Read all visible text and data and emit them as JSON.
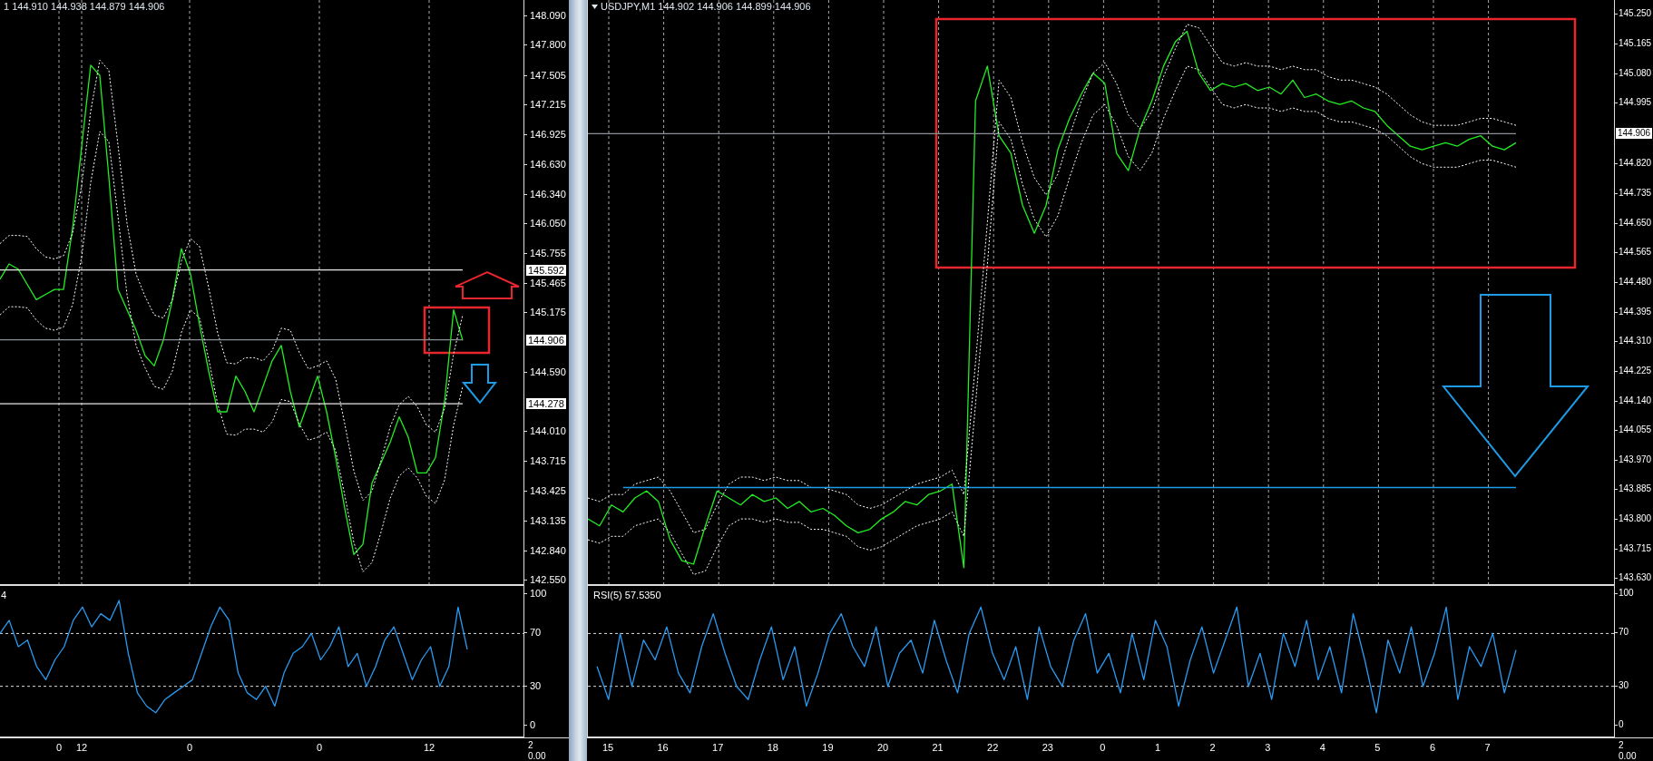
{
  "charts": [
    {
      "header": "1 144.910 144.938 144.879 144.906",
      "chart_data": {
        "type": "line",
        "ylim": [
          142.5,
          148.24
        ],
        "grid": true,
        "yticks": [
          {
            "value": 148.09,
            "label": "148.090"
          },
          {
            "value": 147.8,
            "label": "147.800"
          },
          {
            "value": 147.505,
            "label": "147.505"
          },
          {
            "value": 147.215,
            "label": "147.215"
          },
          {
            "value": 146.925,
            "label": "146.925"
          },
          {
            "value": 146.63,
            "label": "146.630"
          },
          {
            "value": 146.34,
            "label": "146.340"
          },
          {
            "value": 146.05,
            "label": "146.050"
          },
          {
            "value": 145.755,
            "label": "145.755"
          },
          {
            "value": 145.465,
            "label": "145.465"
          },
          {
            "value": 145.175,
            "label": "145.175"
          },
          {
            "value": 144.59,
            "label": "144.590"
          },
          {
            "value": 144.01,
            "label": "144.010"
          },
          {
            "value": 143.715,
            "label": "143.715"
          },
          {
            "value": 143.425,
            "label": "143.425"
          },
          {
            "value": 143.135,
            "label": "143.135"
          },
          {
            "value": 142.84,
            "label": "142.840"
          },
          {
            "value": 142.55,
            "label": "142.550"
          }
        ],
        "series": [
          {
            "color": "#22ee22",
            "values": [
              145.5,
              145.65,
              145.6,
              145.45,
              145.3,
              145.35,
              145.4,
              145.4,
              146.0,
              146.8,
              147.6,
              147.5,
              146.5,
              145.4,
              145.2,
              145.0,
              144.75,
              144.65,
              144.9,
              145.3,
              145.8,
              145.55,
              145.05,
              144.6,
              144.2,
              144.2,
              144.55,
              144.4,
              144.2,
              144.45,
              144.7,
              144.85,
              144.4,
              144.05,
              144.3,
              144.55,
              144.2,
              143.75,
              143.25,
              142.8,
              142.9,
              143.5,
              143.7,
              143.9,
              144.15,
              143.95,
              143.6,
              143.6,
              143.75,
              144.3,
              145.2,
              144.9
            ]
          },
          {
            "line_style": "dashed",
            "color": "#ffffff",
            "values": [
              145.85,
              145.93,
              145.93,
              145.92,
              145.8,
              145.72,
              145.7,
              145.73,
              145.95,
              146.42,
              147.15,
              147.65,
              147.55,
              146.82,
              146.05,
              145.55,
              145.33,
              145.15,
              145.12,
              145.3,
              145.68,
              145.9,
              145.82,
              145.42,
              144.97,
              144.68,
              144.67,
              144.73,
              144.73,
              144.7,
              144.8,
              145.02,
              145.0,
              144.78,
              144.62,
              144.65,
              144.7,
              144.52,
              144.08,
              143.62,
              143.33,
              143.42,
              143.72,
              144.05,
              144.27,
              144.35,
              144.25,
              144.07,
              144.0,
              144.23,
              144.77,
              145.15
            ]
          },
          {
            "color": "#e8e8e8",
            "values": [
              145.592,
              145.592,
              145.592,
              145.592,
              145.592,
              145.592,
              145.592,
              145.592,
              145.592,
              145.592,
              145.592,
              145.592,
              145.592,
              145.592,
              145.592,
              145.592,
              145.592,
              145.592,
              145.592,
              145.592,
              145.592,
              145.592,
              145.592,
              145.592,
              145.592,
              145.592,
              145.592,
              145.592,
              145.592,
              145.592,
              145.592,
              145.592,
              145.592,
              145.592,
              145.592,
              145.592,
              145.592,
              145.592,
              145.592,
              145.592,
              145.592,
              145.592,
              145.592,
              145.592,
              145.592,
              145.592,
              145.592,
              145.592,
              145.592,
              145.592,
              145.592,
              145.592
            ]
          },
          {
            "color": "#8a8f96",
            "values": [
              144.906,
              144.906,
              144.906,
              144.906,
              144.906,
              144.906,
              144.906,
              144.906,
              144.906,
              144.906,
              144.906,
              144.906,
              144.906,
              144.906,
              144.906,
              144.906,
              144.906,
              144.906,
              144.906,
              144.906,
              144.906,
              144.906,
              144.906,
              144.906,
              144.906,
              144.906,
              144.906,
              144.906,
              144.906,
              144.906,
              144.906,
              144.906,
              144.906,
              144.906,
              144.906,
              144.906,
              144.906,
              144.906,
              144.906,
              144.906,
              144.906,
              144.906,
              144.906,
              144.906,
              144.906,
              144.906,
              144.906,
              144.906,
              144.906,
              144.906,
              144.906,
              144.906
            ]
          },
          {
            "color": "#e8e8e8",
            "values": [
              144.278,
              144.278,
              144.278,
              144.278,
              144.278,
              144.278,
              144.278,
              144.278,
              144.278,
              144.278,
              144.278,
              144.278,
              144.278,
              144.278,
              144.278,
              144.278,
              144.278,
              144.278,
              144.278,
              144.278,
              144.278,
              144.278,
              144.278,
              144.278,
              144.278,
              144.278,
              144.278,
              144.278,
              144.278,
              144.278,
              144.278,
              144.278,
              144.278,
              144.278,
              144.278,
              144.278,
              144.278,
              144.278,
              144.278,
              144.278,
              144.278,
              144.278,
              144.278,
              144.278,
              144.278,
              144.278,
              144.278,
              144.278,
              144.278,
              144.278,
              144.278,
              144.278
            ]
          },
          {
            "line_style": "dashed",
            "color": "#ffffff",
            "values": [
              145.15,
              145.23,
              145.23,
              145.22,
              145.1,
              145.02,
              145.0,
              145.03,
              145.25,
              145.72,
              146.45,
              146.95,
              146.85,
              146.12,
              145.35,
              144.85,
              144.63,
              144.45,
              144.42,
              144.6,
              144.98,
              145.2,
              145.12,
              144.72,
              144.27,
              143.98,
              143.97,
              144.03,
              144.03,
              144.0,
              144.1,
              144.32,
              144.3,
              144.08,
              143.92,
              143.95,
              144.0,
              143.82,
              143.38,
              142.92,
              142.63,
              142.72,
              143.02,
              143.35,
              143.57,
              143.65,
              143.55,
              143.37,
              143.3,
              143.53,
              144.07,
              144.45
            ]
          }
        ]
      },
      "levels": [
        {
          "label": "145.592"
        },
        {
          "label": "144.906"
        },
        {
          "label": "144.278"
        }
      ],
      "annotations": [
        {
          "kind": "frame",
          "color": "#e8262e"
        },
        {
          "kind": "up-arrow",
          "color": "#e8262e"
        },
        {
          "kind": "down-arrow",
          "color": "#1e9be6"
        }
      ],
      "rsi": {
        "label": "4",
        "chart_data": {
          "type": "line",
          "ylim": [
            -8,
            106
          ],
          "yticks": [
            {
              "value": 100,
              "label": "100"
            },
            {
              "value": 70,
              "label": "70"
            },
            {
              "value": 30,
              "label": "30"
            },
            {
              "value": 0,
              "label": "0"
            }
          ],
          "series": [
            {
              "color": "#2a9af0",
              "values": [
                70,
                80,
                60,
                65,
                45,
                35,
                50,
                60,
                80,
                90,
                75,
                85,
                80,
                95,
                55,
                25,
                15,
                10,
                20,
                25,
                30,
                35,
                55,
                75,
                90,
                80,
                40,
                25,
                20,
                30,
                15,
                40,
                55,
                60,
                70,
                50,
                60,
                75,
                45,
                55,
                30,
                45,
                65,
                75,
                55,
                35,
                50,
                60,
                30,
                45,
                90,
                58
              ]
            }
          ]
        }
      },
      "time_axis": [
        "0",
        "12",
        "0",
        "0",
        "12"
      ],
      "sub_axis": [
        "2",
        "0.00"
      ]
    },
    {
      "header": "USDJPY,M1  144.902 144.906 144.899 144.906",
      "marker": true,
      "chart_data": {
        "type": "line",
        "ylim": [
          143.61,
          145.29
        ],
        "grid": true,
        "yticks": [
          {
            "value": 145.25,
            "label": "145.250"
          },
          {
            "value": 145.165,
            "label": "145.165"
          },
          {
            "value": 145.08,
            "label": "145.080"
          },
          {
            "value": 144.995,
            "label": "144.995"
          },
          {
            "value": 144.82,
            "label": "144.820"
          },
          {
            "value": 144.735,
            "label": "144.735"
          },
          {
            "value": 144.65,
            "label": "144.650"
          },
          {
            "value": 144.565,
            "label": "144.565"
          },
          {
            "value": 144.48,
            "label": "144.480"
          },
          {
            "value": 144.395,
            "label": "144.395"
          },
          {
            "value": 144.31,
            "label": "144.310"
          },
          {
            "value": 144.225,
            "label": "144.225"
          },
          {
            "value": 144.14,
            "label": "144.140"
          },
          {
            "value": 144.055,
            "label": "144.055"
          },
          {
            "value": 143.97,
            "label": "143.970"
          },
          {
            "value": 143.885,
            "label": "143.885"
          },
          {
            "value": 143.8,
            "label": "143.800"
          },
          {
            "value": 143.715,
            "label": "143.715"
          },
          {
            "value": 143.63,
            "label": "143.630"
          }
        ],
        "series": [
          {
            "color": "#22ee22",
            "values": [
              143.8,
              143.78,
              143.84,
              143.82,
              143.86,
              143.88,
              143.85,
              143.74,
              143.68,
              143.67,
              143.78,
              143.88,
              143.86,
              143.84,
              143.87,
              143.85,
              143.86,
              143.83,
              143.85,
              143.82,
              143.83,
              143.81,
              143.78,
              143.76,
              143.77,
              143.8,
              143.82,
              143.85,
              143.84,
              143.87,
              143.88,
              143.9,
              143.66,
              145.0,
              145.1,
              144.9,
              144.85,
              144.7,
              144.62,
              144.7,
              144.86,
              144.95,
              145.02,
              145.08,
              145.05,
              144.85,
              144.8,
              144.92,
              145.0,
              145.1,
              145.17,
              145.2,
              145.08,
              145.03,
              145.05,
              145.04,
              145.05,
              145.03,
              145.04,
              145.02,
              145.06,
              145.01,
              145.02,
              145.0,
              144.99,
              145.0,
              144.98,
              144.97,
              144.93,
              144.9,
              144.87,
              144.86,
              144.87,
              144.88,
              144.87,
              144.89,
              144.9,
              144.87,
              144.86,
              144.88
            ]
          },
          {
            "line_style": "dashed",
            "color": "#ffffff",
            "values": [
              143.86,
              143.85,
              143.87,
              143.87,
              143.9,
              143.91,
              143.92,
              143.88,
              143.82,
              143.76,
              143.77,
              143.84,
              143.9,
              143.92,
              143.92,
              143.91,
              143.92,
              143.91,
              143.91,
              143.89,
              143.89,
              143.88,
              143.87,
              143.84,
              143.83,
              143.84,
              143.86,
              143.88,
              143.9,
              143.91,
              143.92,
              143.94,
              143.87,
              144.25,
              144.65,
              145.06,
              145.01,
              144.88,
              144.78,
              144.73,
              144.79,
              144.9,
              145.0,
              145.08,
              145.11,
              145.05,
              144.96,
              144.92,
              144.97,
              145.07,
              145.15,
              145.22,
              145.21,
              145.16,
              145.11,
              145.1,
              145.11,
              145.1,
              145.1,
              145.09,
              145.1,
              145.09,
              145.09,
              145.07,
              145.06,
              145.06,
              145.05,
              145.04,
              145.02,
              144.99,
              144.96,
              144.94,
              144.93,
              144.93,
              144.93,
              144.94,
              144.95,
              144.95,
              144.94,
              144.93
            ]
          },
          {
            "color": "#8a8f96",
            "values": [
              144.906,
              144.906,
              144.906,
              144.906,
              144.906,
              144.906,
              144.906,
              144.906,
              144.906,
              144.906,
              144.906,
              144.906,
              144.906,
              144.906,
              144.906,
              144.906,
              144.906,
              144.906,
              144.906,
              144.906,
              144.906,
              144.906,
              144.906,
              144.906,
              144.906,
              144.906,
              144.906,
              144.906,
              144.906,
              144.906,
              144.906,
              144.906,
              144.906,
              144.906,
              144.906,
              144.906,
              144.906,
              144.906,
              144.906,
              144.906,
              144.906,
              144.906,
              144.906,
              144.906,
              144.906,
              144.906,
              144.906,
              144.906,
              144.906,
              144.906,
              144.906,
              144.906,
              144.906,
              144.906,
              144.906,
              144.906,
              144.906,
              144.906,
              144.906,
              144.906,
              144.906,
              144.906,
              144.906,
              144.906,
              144.906,
              144.906,
              144.906,
              144.906,
              144.906,
              144.906,
              144.906,
              144.906,
              144.906,
              144.906,
              144.906,
              144.906,
              144.906,
              144.906,
              144.906,
              144.906
            ]
          },
          {
            "color": "#1e9be6",
            "values": [
              null,
              null,
              null,
              143.89,
              143.89,
              143.89,
              143.89,
              143.89,
              143.89,
              143.89,
              143.89,
              143.89,
              143.89,
              143.89,
              143.89,
              143.89,
              143.89,
              143.89,
              143.89,
              143.89,
              143.89,
              143.89,
              143.89,
              143.89,
              143.89,
              143.89,
              143.89,
              143.89,
              143.89,
              143.89,
              143.89,
              143.89,
              143.89,
              143.89,
              143.89,
              143.89,
              143.89,
              143.89,
              143.89,
              143.89,
              143.89,
              143.89,
              143.89,
              143.89,
              143.89,
              143.89,
              143.89,
              143.89,
              143.89,
              143.89,
              143.89,
              143.89,
              143.89,
              143.89,
              143.89,
              143.89,
              143.89,
              143.89,
              143.89,
              143.89,
              143.89,
              143.89,
              143.89,
              143.89,
              143.89,
              143.89,
              143.89,
              143.89,
              143.89,
              143.89,
              143.89,
              143.89,
              143.89,
              143.89,
              143.89,
              143.89,
              143.89,
              143.89,
              143.89,
              143.89
            ]
          },
          {
            "line_style": "dashed",
            "color": "#ffffff",
            "values": [
              143.74,
              143.73,
              143.75,
              143.75,
              143.78,
              143.79,
              143.8,
              143.76,
              143.7,
              143.64,
              143.65,
              143.72,
              143.78,
              143.8,
              143.8,
              143.79,
              143.8,
              143.79,
              143.79,
              143.77,
              143.77,
              143.76,
              143.75,
              143.72,
              143.71,
              143.72,
              143.74,
              143.76,
              143.78,
              143.79,
              143.8,
              143.82,
              143.75,
              144.13,
              144.53,
              144.94,
              144.89,
              144.76,
              144.66,
              144.61,
              144.67,
              144.78,
              144.88,
              144.96,
              144.99,
              144.93,
              144.84,
              144.8,
              144.85,
              144.95,
              145.03,
              145.1,
              145.09,
              145.04,
              144.99,
              144.98,
              144.99,
              144.98,
              144.98,
              144.97,
              144.98,
              144.97,
              144.97,
              144.95,
              144.94,
              144.94,
              144.93,
              144.92,
              144.9,
              144.87,
              144.84,
              144.82,
              144.81,
              144.81,
              144.81,
              144.82,
              144.83,
              144.83,
              144.82,
              144.81
            ]
          }
        ]
      },
      "levels": [
        {
          "label": "144.906"
        }
      ],
      "annotations": [
        {
          "kind": "frame",
          "color": "#e8262e"
        },
        {
          "kind": "down-arrow",
          "color": "#1e9be6"
        }
      ],
      "rsi": {
        "label": "RSI(5) 57.5350",
        "chart_data": {
          "type": "line",
          "ylim": [
            -8,
            106
          ],
          "yticks": [
            {
              "value": 100,
              "label": "100"
            },
            {
              "value": 70,
              "label": "70"
            },
            {
              "value": 30,
              "label": "30"
            },
            {
              "value": 0,
              "label": "0"
            }
          ],
          "series": [
            {
              "color": "#2a9af0",
              "values": [
                45,
                20,
                70,
                30,
                65,
                50,
                75,
                40,
                25,
                60,
                85,
                55,
                30,
                20,
                50,
                75,
                35,
                60,
                15,
                40,
                70,
                85,
                60,
                45,
                75,
                30,
                55,
                65,
                40,
                80,
                50,
                25,
                70,
                90,
                55,
                35,
                60,
                20,
                75,
                45,
                30,
                65,
                85,
                40,
                55,
                25,
                70,
                35,
                80,
                60,
                15,
                50,
                75,
                40,
                65,
                90,
                30,
                55,
                20,
                70,
                45,
                80,
                35,
                60,
                25,
                85,
                50,
                10,
                65,
                40,
                75,
                30,
                55,
                90,
                20,
                60,
                45,
                70,
                25,
                57.5
              ]
            }
          ]
        }
      },
      "time_axis": [
        "15",
        "16",
        "17",
        "18",
        "19",
        "20",
        "21",
        "22",
        "23",
        "0",
        "1",
        "2",
        "3",
        "4",
        "5",
        "6",
        "7"
      ],
      "sub_axis": [
        "2",
        "0.00"
      ]
    }
  ]
}
